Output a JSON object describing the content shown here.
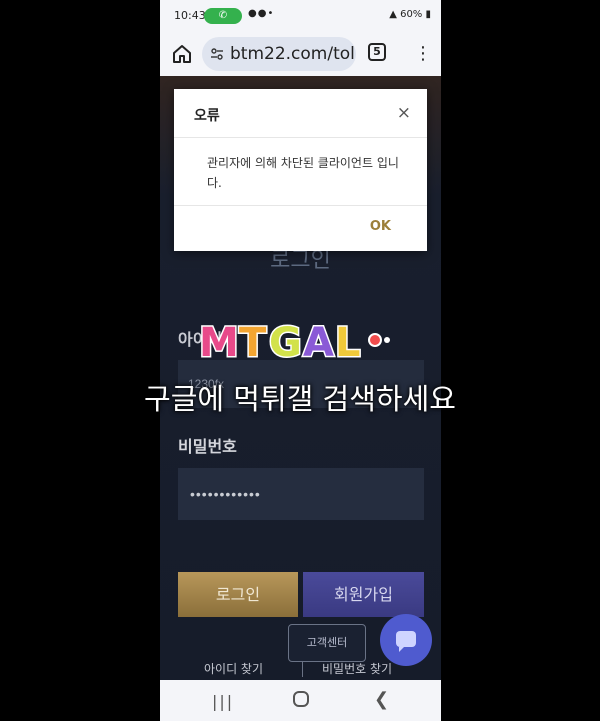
{
  "status_bar": {
    "time": "10:43",
    "battery": "60%"
  },
  "browser": {
    "url": "btm22.com/tol",
    "tab_count": "5"
  },
  "login_page": {
    "title": "로그인",
    "id_label": "아이디",
    "id_value": "1230fx",
    "password_label": "비밀번호",
    "password_value": "••••••••••••",
    "login_button": "로그인",
    "signup_button": "회원가입",
    "support_button": "고객센터",
    "find_id": "아이디 찾기",
    "find_password": "비밀번호 찾기"
  },
  "dialog": {
    "title": "오류",
    "close": "×",
    "message": "관리자에 의해 차단된 클라이언트 입니다.",
    "ok": "OK"
  },
  "watermark": {
    "logo": "MTGAL",
    "text": "구글에 먹튀갤 검색하세요"
  },
  "colors": {
    "page_bg": "#1b2232",
    "login_gold": "#b8975a",
    "signup_purple": "#3a3a82",
    "chat_blue": "#4f5bcf",
    "ok_gold": "#9c7f3a"
  }
}
